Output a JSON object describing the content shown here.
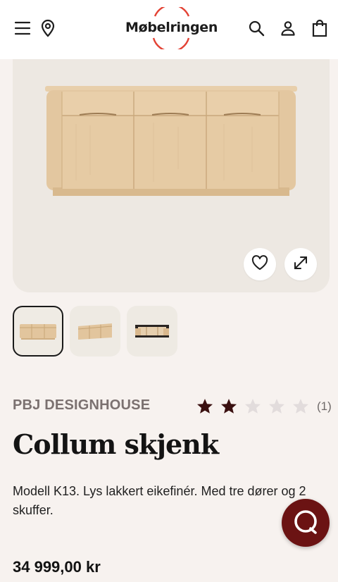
{
  "header": {
    "logo_text": "Møbelringen",
    "icons": [
      "menu-icon",
      "location-pin-icon",
      "search-icon",
      "user-icon",
      "shopping-bag-icon"
    ],
    "logo_ring_color": "#e34234"
  },
  "gallery": {
    "icons": [
      "heart-icon",
      "expand-icon"
    ],
    "thumbnails": [
      "thumbnail-1",
      "thumbnail-2",
      "thumbnail-3"
    ],
    "active_thumbnail": 0
  },
  "product": {
    "brand": "PBJ DESIGNHOUSE",
    "rating": 2,
    "rating_max": 5,
    "review_count": "(1)",
    "title": "Collum skjenk",
    "description": "Modell K13. Lys lakkert eikefinér. Med tre dører og 2 skuffer.",
    "price": "34 999,00 kr"
  },
  "chat": {
    "icon": "chat-icon",
    "color": "#6b1313"
  },
  "colors": {
    "page_background": "#f7f2ef",
    "hero_background": "#ede8e2",
    "star_filled": "#3a1010",
    "star_empty": "#e2dcdc"
  }
}
